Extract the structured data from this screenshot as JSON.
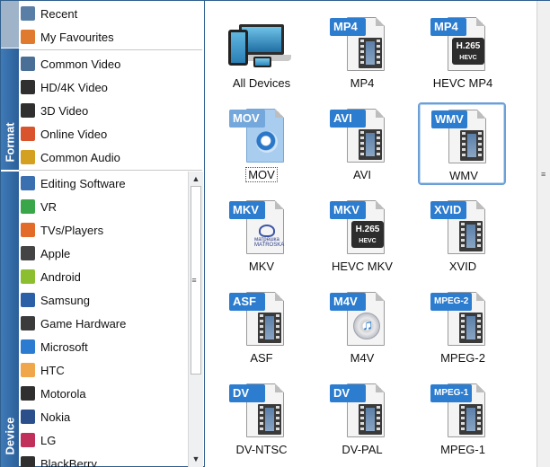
{
  "sidebar": {
    "format_label": "Format",
    "device_label": "Device",
    "top_items": [
      {
        "label": "Recent",
        "icon": "recent-icon",
        "color": "#5a7fa6"
      },
      {
        "label": "My Favourites",
        "icon": "heart-icon",
        "color": "#e07a2e"
      }
    ],
    "format_items": [
      {
        "label": "Common Video",
        "icon": "film-icon",
        "color": "#4a6f96"
      },
      {
        "label": "HD/4K Video",
        "icon": "hd-icon",
        "color": "#2f2f2f"
      },
      {
        "label": "3D Video",
        "icon": "3d-icon",
        "color": "#2f2f2f"
      },
      {
        "label": "Online Video",
        "icon": "online-video-icon",
        "color": "#d9532c"
      },
      {
        "label": "Common Audio",
        "icon": "music-note-icon",
        "color": "#d4a022"
      }
    ],
    "device_items": [
      {
        "label": "Editing Software",
        "icon": "editing-software-icon",
        "color": "#3a6fb0"
      },
      {
        "label": "VR",
        "icon": "vr-icon",
        "color": "#3aa64a"
      },
      {
        "label": "TVs/Players",
        "icon": "tv-icon",
        "color": "#e26b2a"
      },
      {
        "label": "Apple",
        "icon": "apple-icon",
        "color": "#444444"
      },
      {
        "label": "Android",
        "icon": "android-icon",
        "color": "#8cbf2f"
      },
      {
        "label": "Samsung",
        "icon": "samsung-phone-icon",
        "color": "#2b5fa6"
      },
      {
        "label": "Game Hardware",
        "icon": "game-controller-icon",
        "color": "#3b3b3b"
      },
      {
        "label": "Microsoft",
        "icon": "microsoft-icon",
        "color": "#2b7cd0"
      },
      {
        "label": "HTC",
        "icon": "htc-icon",
        "color": "#f0a64a"
      },
      {
        "label": "Motorola",
        "icon": "motorola-phone-icon",
        "color": "#2f2f2f"
      },
      {
        "label": "Nokia",
        "icon": "nokia-phone-icon",
        "color": "#2b4f8a"
      },
      {
        "label": "LG",
        "icon": "lg-phone-icon",
        "color": "#c0305a"
      },
      {
        "label": "BlackBerry",
        "icon": "blackberry-icon",
        "color": "#2f2f2f"
      }
    ]
  },
  "formats": [
    {
      "label": "All Devices",
      "badge": "",
      "kind": "devices"
    },
    {
      "label": "MP4",
      "badge": "MP4",
      "kind": "film"
    },
    {
      "label": "HEVC MP4",
      "badge": "MP4",
      "kind": "hevc",
      "codec": "H.265",
      "codec_sub": "HEVC"
    },
    {
      "label": "MOV",
      "badge": "MOV",
      "kind": "mov"
    },
    {
      "label": "AVI",
      "badge": "AVI",
      "kind": "film"
    },
    {
      "label": "WMV",
      "badge": "WMV",
      "kind": "film",
      "selected": true
    },
    {
      "label": "MKV",
      "badge": "MKV",
      "kind": "mkv",
      "mkv_text": "матрёшка MATROSKA"
    },
    {
      "label": "HEVC MKV",
      "badge": "MKV",
      "kind": "hevc",
      "codec": "H.265",
      "codec_sub": "HEVC"
    },
    {
      "label": "XVID",
      "badge": "XVID",
      "kind": "film"
    },
    {
      "label": "ASF",
      "badge": "ASF",
      "kind": "film"
    },
    {
      "label": "M4V",
      "badge": "M4V",
      "kind": "m4v"
    },
    {
      "label": "MPEG-2",
      "badge": "MPEG-2",
      "kind": "film",
      "small": true
    },
    {
      "label": "DV-NTSC",
      "badge": "DV",
      "kind": "film"
    },
    {
      "label": "DV-PAL",
      "badge": "DV",
      "kind": "film"
    },
    {
      "label": "MPEG-1",
      "badge": "MPEG-1",
      "kind": "film",
      "small": true
    }
  ],
  "scrollbars": {
    "up_arrow": "▲",
    "down_arrow": "▼",
    "grip": "≡"
  }
}
